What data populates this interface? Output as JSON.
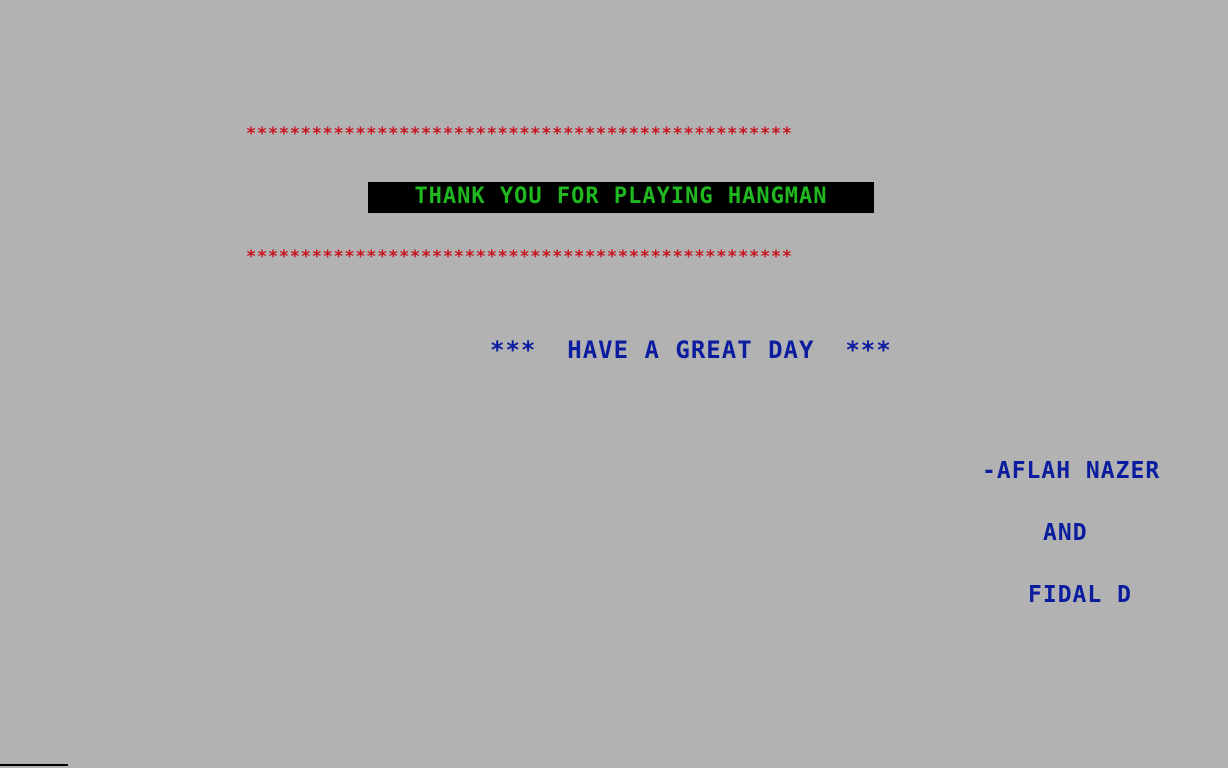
{
  "stars_line": "**************************************************",
  "banner": {
    "text": "THANK YOU FOR PLAYING HANGMAN"
  },
  "greeting": "***  HAVE A GREAT DAY  ***",
  "credits": {
    "author1": "-AFLAH NAZER",
    "conjunction": "AND",
    "author2": "FIDAL D"
  },
  "colors": {
    "background": "#b2b2b2",
    "stars": "#c8141e",
    "banner_bg": "#000000",
    "banner_text": "#1fb81f",
    "text_blue": "#0b1d9e"
  }
}
